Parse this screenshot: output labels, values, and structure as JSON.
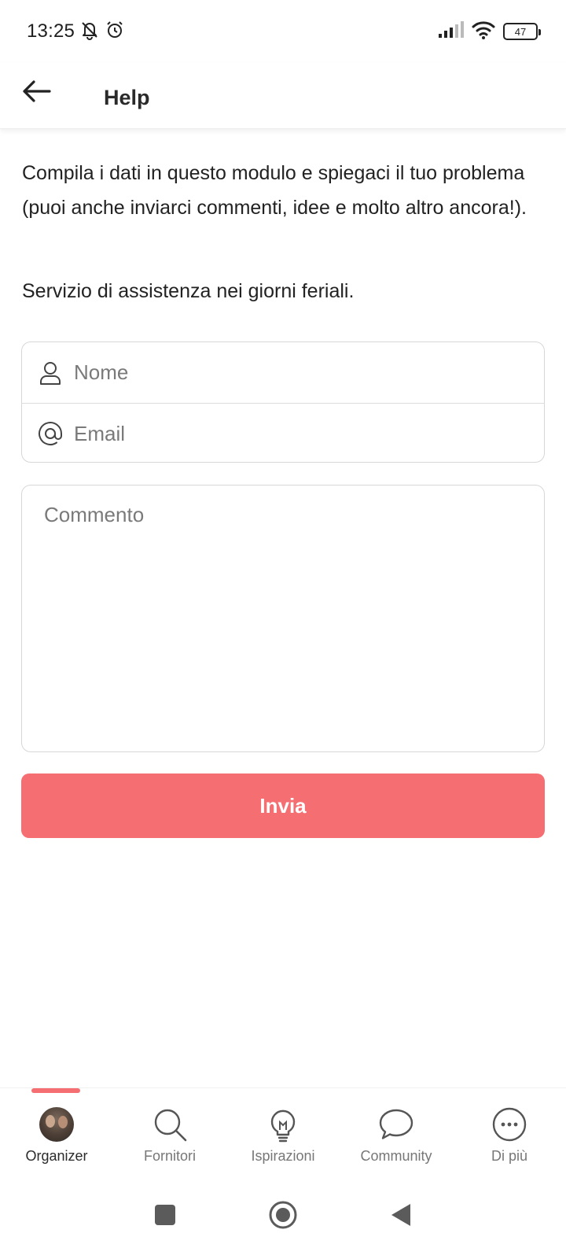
{
  "status_bar": {
    "time": "13:25",
    "battery": "47",
    "icons": [
      "bell-off-icon",
      "alarm-icon",
      "signal-icon",
      "wifi-icon",
      "battery-icon"
    ]
  },
  "header": {
    "title": "Help",
    "back_icon": "arrow-left-icon"
  },
  "intro": {
    "description": "Compila i dati in questo modulo e spiegaci il tuo problema (puoi anche inviarci commenti, idee e molto altro ancora!).",
    "service_hours": "Servizio di assistenza nei giorni feriali."
  },
  "form": {
    "name": {
      "placeholder": "Nome",
      "value": "",
      "icon": "user-icon"
    },
    "email": {
      "placeholder": "Email",
      "value": "",
      "icon": "at-sign-icon"
    },
    "comment": {
      "placeholder": "Commento",
      "value": ""
    },
    "submit_label": "Invia"
  },
  "bottom_nav": {
    "items": [
      {
        "label": "Organizer",
        "icon": "avatar",
        "active": true
      },
      {
        "label": "Fornitori",
        "icon": "search-icon",
        "active": false
      },
      {
        "label": "Ispirazioni",
        "icon": "lightbulb-icon",
        "active": false
      },
      {
        "label": "Community",
        "icon": "chat-bubble-icon",
        "active": false
      },
      {
        "label": "Di più",
        "icon": "more-icon",
        "active": false
      }
    ]
  },
  "colors": {
    "accent": "#f46e72",
    "text": "#222222",
    "placeholder": "#7a7a7a",
    "border": "#d7d7d7"
  }
}
